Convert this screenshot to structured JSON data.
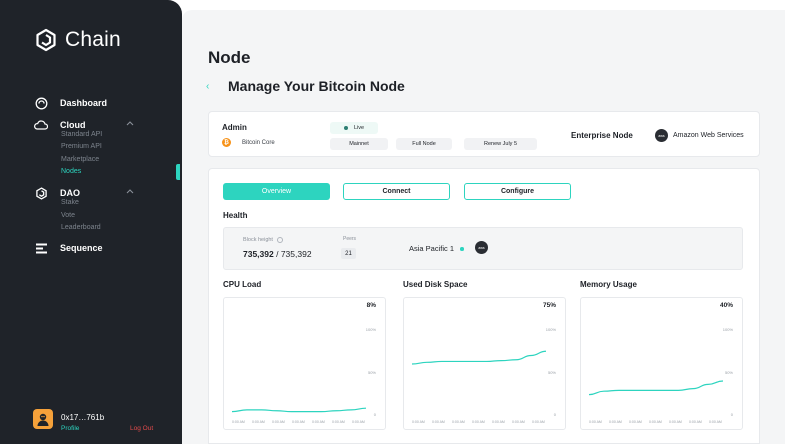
{
  "brand": {
    "name": "Chain"
  },
  "sidebar": {
    "sections": [
      {
        "label": "Dashboard",
        "icon": "dashboard-icon",
        "subitems": []
      },
      {
        "label": "Cloud",
        "icon": "cloud-icon",
        "subitems": [
          "Standard API",
          "Premium API",
          "Marketplace",
          "Nodes"
        ]
      },
      {
        "label": "DAO",
        "icon": "dao-icon",
        "subitems": [
          "Stake",
          "Vote",
          "Leaderboard"
        ]
      },
      {
        "label": "Sequence",
        "icon": "sequence-icon",
        "subitems": []
      }
    ],
    "active_item": "Nodes",
    "profile": {
      "address": "0x17…761b",
      "profile_label": "Profile",
      "logout_label": "Log Out"
    }
  },
  "page": {
    "title": "Node",
    "subtitle": "Manage Your Bitcoin Node"
  },
  "node_info": {
    "admin_label": "Admin",
    "chain_label": "Bitcoin Core",
    "status": "Live",
    "network": "Mainnet",
    "node_type": "Full Node",
    "renewal": "Renew July 5",
    "plan": "Enterprise Node",
    "provider_logo_text": "aws",
    "provider": "Amazon Web Services"
  },
  "tabs": [
    {
      "label": "Overview",
      "active": true
    },
    {
      "label": "Connect",
      "active": false
    },
    {
      "label": "Configure",
      "active": false
    }
  ],
  "health": {
    "title": "Health",
    "block_height_label": "Block height",
    "block_height_current": "735,392",
    "block_height_total": " / 735,392",
    "peers_label": "Peers",
    "peers_value": "21",
    "region": "Asia Pacific 1",
    "region_logo_text": "aws"
  },
  "metrics": [
    {
      "title": "CPU Load",
      "value_label": "8%",
      "ticks": [
        "100%",
        "50%",
        "0"
      ],
      "x_labels": [
        "0:00 AM",
        "0:00 AM",
        "0:00 AM",
        "0:00 AM",
        "0:00 AM",
        "0:00 AM",
        "0:00 AM"
      ],
      "series": [
        4,
        6,
        6,
        5,
        4,
        4,
        4,
        5,
        6,
        8
      ]
    },
    {
      "title": "Used Disk Space",
      "value_label": "75%",
      "ticks": [
        "100%",
        "50%",
        "0"
      ],
      "x_labels": [
        "0:00 AM",
        "0:00 AM",
        "0:00 AM",
        "0:00 AM",
        "0:00 AM",
        "0:00 AM",
        "0:00 AM"
      ],
      "series": [
        60,
        62,
        63,
        63,
        63,
        63,
        64,
        65,
        70,
        75
      ]
    },
    {
      "title": "Memory Usage",
      "value_label": "40%",
      "ticks": [
        "100%",
        "50%",
        "0"
      ],
      "x_labels": [
        "0:00 AM",
        "0:00 AM",
        "0:00 AM",
        "0:00 AM",
        "0:00 AM",
        "0:00 AM",
        "0:00 AM"
      ],
      "series": [
        24,
        28,
        29,
        29,
        29,
        29,
        29,
        31,
        36,
        40
      ]
    }
  ],
  "colors": {
    "accent": "#2dd4bf",
    "sidebar": "#1f2329",
    "bitcoin": "#f7931a",
    "logout": "#e34b4b"
  }
}
